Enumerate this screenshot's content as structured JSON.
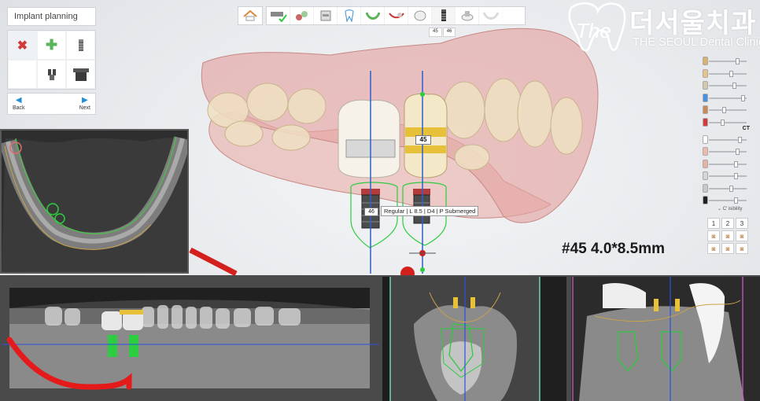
{
  "panel": {
    "title": "Implant planning",
    "tools": [
      {
        "icon": "delete-x-icon"
      },
      {
        "icon": "add-plus-icon"
      },
      {
        "icon": "implant-icon"
      },
      {
        "icon": "empty"
      },
      {
        "icon": "abutment-icon"
      },
      {
        "icon": "sleeve-icon"
      }
    ],
    "back_label": "Back",
    "next_label": "Next"
  },
  "toolbar": {
    "items": [
      "home-icon",
      "model-check-icon",
      "tooth-extract-icon",
      "scan-icon",
      "tooth-icon",
      "arch-icon",
      "nerve-icon",
      "crown-icon",
      "implant-icon",
      "sleeve-icon",
      "guide-icon"
    ],
    "active_index": 8,
    "sub_tabs": [
      "45",
      "46"
    ]
  },
  "logo": {
    "korean": "더서울치과",
    "english": "THE SEOUL Dental Clinic",
    "script": "The"
  },
  "model_view": {
    "implant_tag_45": "45",
    "implant_tag_46": "46",
    "info_text": "Regular | L 8.5 | D4 | P Submerged",
    "implant_size_label": "#45  4.0*8.5mm"
  },
  "sliders": {
    "ct_label": "CT",
    "visibility_label": "C' isibility",
    "levels": [
      0.8,
      0.6,
      0.7,
      0.95,
      0.4,
      0.35,
      0.85,
      0.8,
      0.75,
      0.75,
      0.6,
      0.75
    ],
    "swatch_colors": [
      "#d9b36a",
      "#e6c488",
      "#d2c8b0",
      "#4a90e2",
      "#c98a55",
      "#d23a3a",
      "#ffffff",
      "#f1b9a8",
      "#e8b4a0",
      "#d6d6d6",
      "#c9c9c9",
      "#222222"
    ]
  },
  "view_buttons": [
    "1",
    "2",
    "3"
  ],
  "colors": {
    "accent_blue": "#1f8fd8",
    "delete_red": "#d23a3a",
    "add_green": "#5bb35b",
    "canal_green": "#2ecc40",
    "nerve_red": "#e51b1b",
    "crown_gold": "#e7c13a"
  }
}
